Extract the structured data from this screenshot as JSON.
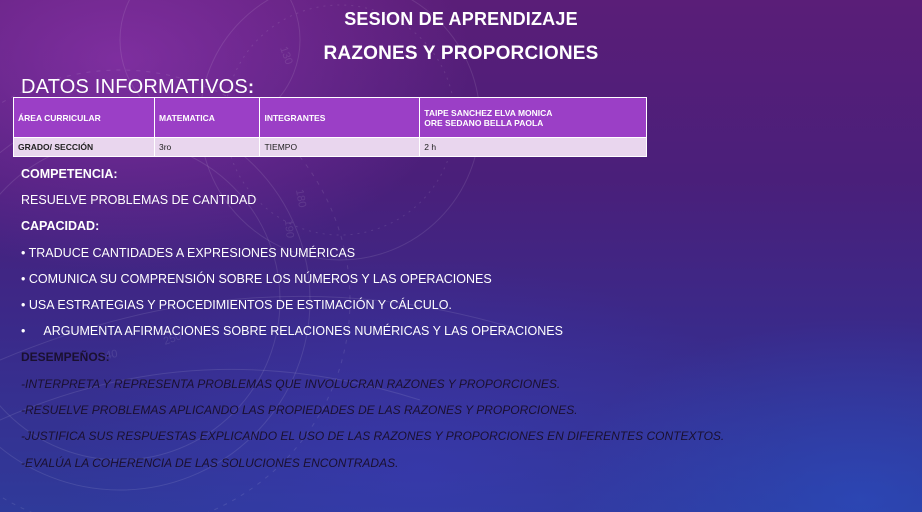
{
  "title_line1": "SESION DE APRENDIZAJE",
  "title_line2": "RAZONES Y PROPORCIONES",
  "datos_heading": "DATOS INFORMATIVOS",
  "datos_colon": ":",
  "table": {
    "row1": {
      "label": "ÁREA CURRICULAR",
      "value": "MATEMATICA",
      "label2": "INTEGRANTES",
      "value2_line1": "TAIPE SANCHEZ ELVA MONICA",
      "value2_line2": "ORE SEDANO BELLA PAOLA"
    },
    "row2": {
      "label": "GRADO/ SECCIÓN",
      "value": "3ro",
      "label2": "TIEMPO",
      "value2": "2 h"
    }
  },
  "competencia_heading": "COMPETENCIA:",
  "competencia_text": "RESUELVE PROBLEMAS DE CANTIDAD",
  "capacidad_heading": "CAPACIDAD:",
  "bullet_char": "•",
  "capacidades": [
    "TRADUCE CANTIDADES A EXPRESIONES NUMÉRICAS",
    "COMUNICA SU COMPRENSIÓN SOBRE LOS NÚMEROS Y LAS OPERACIONES",
    "USA ESTRATEGIAS Y PROCEDIMIENTOS DE ESTIMACIÓN Y CÁLCULO.",
    "ARGUMENTA AFIRMACIONES SOBRE RELACIONES NUMÉRICAS Y LAS OPERACIONES"
  ],
  "desempenos_heading": "DESEMPEÑOS:",
  "desempenos": [
    "-INTERPRETA Y REPRESENTA PROBLEMAS QUE INVOLUCRAN RAZONES Y PROPORCIONES.",
    "-RESUELVE PROBLEMAS APLICANDO LAS PROPIEDADES DE LAS RAZONES Y PROPORCIONES.",
    "-JUSTIFICA SUS RESPUESTAS EXPLICANDO EL USO DE LAS RAZONES Y PROPORCIONES EN DIFERENTES CONTEXTOS.",
    "-EVALÚA LA COHERENCIA DE LAS SOLUCIONES ENCONTRADAS."
  ],
  "colors": {
    "table_header_bg": "#9b3fc6",
    "table_row_bg": "#e9d6ee",
    "text": "#ffffff",
    "dark_text": "#1a1030"
  }
}
